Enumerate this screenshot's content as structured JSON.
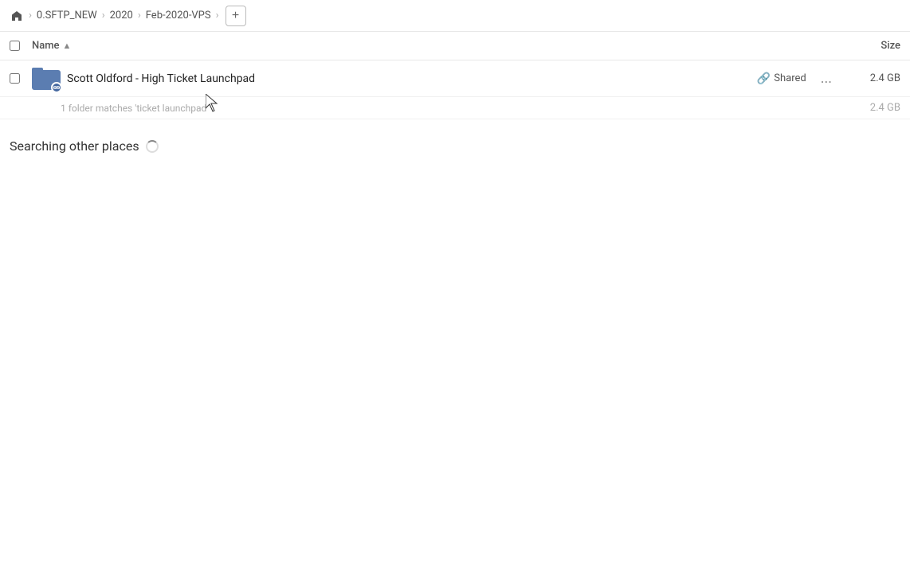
{
  "breadcrumb": {
    "home_icon": "🏠",
    "items": [
      {
        "label": "0.SFTP_NEW",
        "id": "sftp-new"
      },
      {
        "label": "2020",
        "id": "2020"
      },
      {
        "label": "Feb-2020-VPS",
        "id": "feb-2020-vps"
      }
    ],
    "add_button_label": "+"
  },
  "columns": {
    "name_label": "Name",
    "sort_indicator": "▲",
    "size_label": "Size"
  },
  "file_row": {
    "checkbox_checked": false,
    "icon_type": "folder-shared",
    "name": "Scott Oldford - High Ticket Launchpad",
    "shared_label": "Shared",
    "more_icon": "...",
    "size": "2.4 GB"
  },
  "match_info": {
    "text": "1 folder matches 'ticket launchpad'",
    "size": "2.4 GB"
  },
  "searching": {
    "text": "Searching other places",
    "spinner": true
  }
}
